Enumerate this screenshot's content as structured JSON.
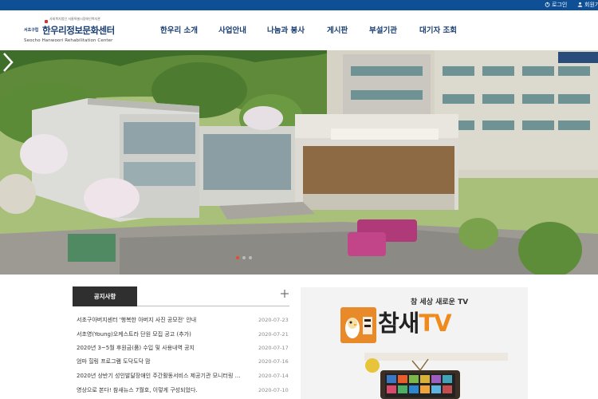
{
  "topbar": {
    "login_label": "로그인",
    "join_label": "회원가입",
    "bg_color": "#0e4f95"
  },
  "logo": {
    "tagline": "사회복지법인 서울특별시장애인복지관",
    "org_short": "서초구립",
    "name": "한우리정보문화센터",
    "name_en": "Seocho Hanwoori Rehabilitation Center"
  },
  "nav": {
    "items": [
      {
        "label": "한우리 소개"
      },
      {
        "label": "사업안내"
      },
      {
        "label": "나눔과 봉사"
      },
      {
        "label": "게시판"
      },
      {
        "label": "부설기관"
      },
      {
        "label": "대기자 조회"
      }
    ]
  },
  "hero": {
    "next_icon": "chevron-right-icon",
    "slide_count": 3,
    "active_slide": 1
  },
  "notice": {
    "tab_label": "공지사항",
    "more_icon": "plus-icon",
    "rows": [
      {
        "title": "서초구아버지센터 '행복한 아버지 사진 공모전' 안내",
        "date": "2020-07-23"
      },
      {
        "title": "서초영(Young)오케스트라 단원 모집 공고 (추가)",
        "date": "2020-07-21"
      },
      {
        "title": "2020년 3~5월 후원금(품) 수입 및 사용내역 공지",
        "date": "2020-07-17"
      },
      {
        "title": "엄마 힐링 프로그램 도닥도닥 맘",
        "date": "2020-07-16"
      },
      {
        "title": "2020년 상반기 성인발달장애인 주간활동서비스 제공기관 모니터링 …",
        "date": "2020-07-14"
      },
      {
        "title": "영상으로 본다! 참새뉴스 7월호, 이렇게 구성되었다.",
        "date": "2020-07-10"
      }
    ]
  },
  "tvbanner": {
    "slogan": "참 세상 새로운 TV",
    "title_kr": "참새",
    "title_tv": "TV",
    "accent_color": "#f08a1c"
  }
}
